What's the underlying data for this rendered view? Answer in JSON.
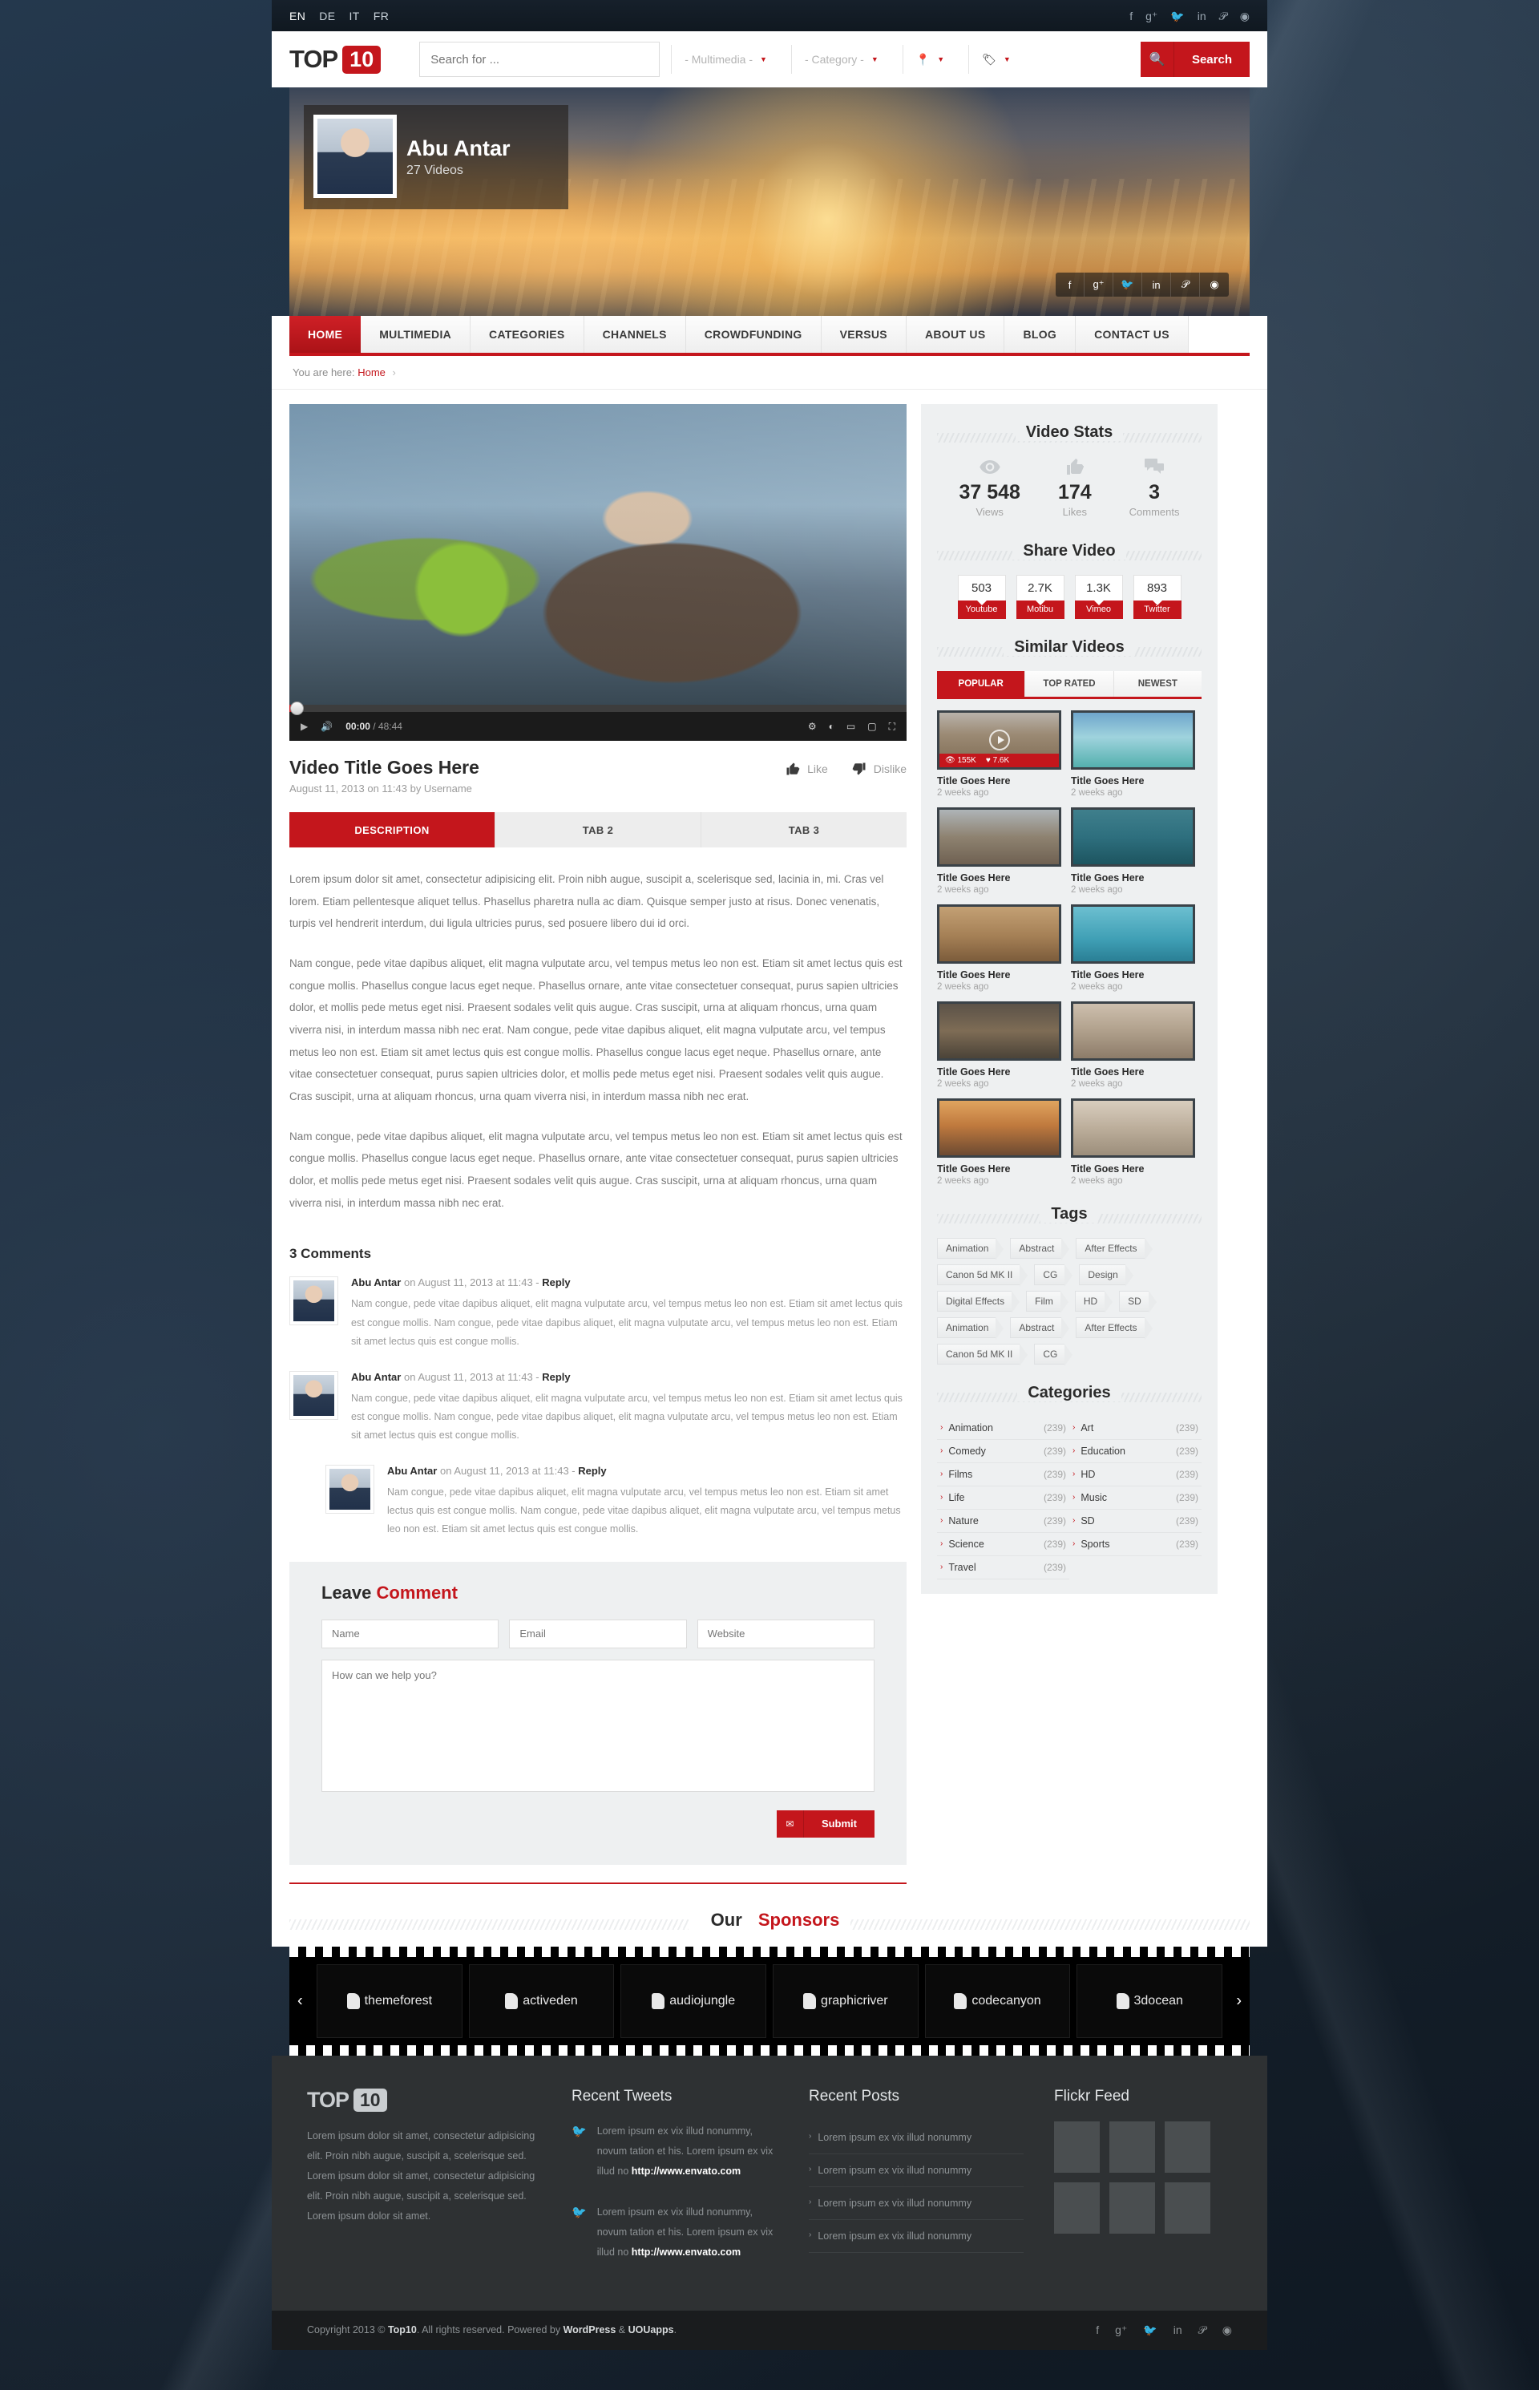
{
  "topbar": {
    "languages": [
      {
        "code": "EN",
        "active": true
      },
      {
        "code": "DE",
        "active": false
      },
      {
        "code": "IT",
        "active": false
      },
      {
        "code": "FR",
        "active": false
      }
    ],
    "social": [
      "facebook-icon",
      "google-plus-icon",
      "twitter-icon",
      "linkedin-icon",
      "pinterest-icon",
      "dribbble-icon"
    ]
  },
  "header": {
    "logo_text": "TOP",
    "logo_badge": "10",
    "search_placeholder": "Search for ...",
    "search_value": "",
    "multimedia_select": "- Multimedia -",
    "category_select": "- Category -",
    "location_icon": "map-pin-icon",
    "tag_icon": "tag-icon",
    "search_button": "Search",
    "search_icon": "search-icon"
  },
  "hero": {
    "user_name": "Abu Antar",
    "video_count": "27 Videos",
    "social": [
      "facebook-icon",
      "google-plus-icon",
      "twitter-icon",
      "linkedin-icon",
      "pinterest-icon",
      "dribbble-icon"
    ]
  },
  "nav": {
    "items": [
      {
        "label": "HOME",
        "active": true
      },
      {
        "label": "MULTIMEDIA",
        "active": false
      },
      {
        "label": "CATEGORIES",
        "active": false
      },
      {
        "label": "CHANNELS",
        "active": false
      },
      {
        "label": "CROWDFUNDING",
        "active": false
      },
      {
        "label": "VERSUS",
        "active": false
      },
      {
        "label": "ABOUT US",
        "active": false
      },
      {
        "label": "BLOG",
        "active": false
      },
      {
        "label": "CONTACT US",
        "active": false
      }
    ]
  },
  "breadcrumb": {
    "prefix": "You are here:",
    "current": "Home",
    "arrow": "›"
  },
  "player": {
    "current_time": "00:00",
    "total_time": "48:44",
    "time_separator": "/",
    "play_icon": "play-icon",
    "volume_icon": "volume-icon",
    "settings_icon": "gear-icon",
    "hd_icon": "quality-icon",
    "theater_icon": "theater-mode-icon",
    "mini_icon": "miniplayer-icon",
    "fullscreen_icon": "fullscreen-icon"
  },
  "video": {
    "title": "Video Title Goes Here",
    "meta": "August 11, 2013 on 11:43 by Username",
    "like_label": "Like",
    "dislike_label": "Dislike",
    "tabs": [
      {
        "label": "DESCRIPTION",
        "active": true
      },
      {
        "label": "TAB 2",
        "active": false
      },
      {
        "label": "TAB 3",
        "active": false
      }
    ],
    "paragraphs": [
      "Lorem ipsum dolor sit amet, consectetur adipisicing elit. Proin nibh augue, suscipit a, scelerisque sed, lacinia in, mi. Cras vel lorem. Etiam pellentesque aliquet tellus. Phasellus pharetra nulla ac diam. Quisque semper justo at risus. Donec venenatis, turpis vel hendrerit interdum, dui ligula ultricies purus, sed posuere libero dui id orci.",
      "Nam congue, pede vitae dapibus aliquet, elit magna vulputate arcu, vel tempus metus leo non est. Etiam sit amet lectus quis est congue mollis. Phasellus congue lacus eget neque. Phasellus ornare, ante vitae consectetuer consequat, purus sapien ultricies dolor, et mollis pede metus eget nisi. Praesent sodales velit quis augue. Cras suscipit, urna at aliquam rhoncus, urna quam viverra nisi, in interdum massa nibh nec erat. Nam congue, pede vitae dapibus aliquet, elit magna vulputate arcu, vel tempus metus leo non est. Etiam sit amet lectus quis est congue mollis. Phasellus congue lacus eget neque. Phasellus ornare, ante vitae consectetuer consequat, purus sapien ultricies dolor, et mollis pede metus eget nisi. Praesent sodales velit quis augue. Cras suscipit, urna at aliquam rhoncus, urna quam viverra nisi, in interdum massa nibh nec erat.",
      "Nam congue, pede vitae dapibus aliquet, elit magna vulputate arcu, vel tempus metus leo non est. Etiam sit amet lectus quis est congue mollis. Phasellus congue lacus eget neque. Phasellus ornare, ante vitae consectetuer consequat, purus sapien ultricies dolor, et mollis pede metus eget nisi. Praesent sodales velit quis augue. Cras suscipit, urna at aliquam rhoncus, urna quam viverra nisi, in interdum massa nibh nec erat."
    ]
  },
  "comments": {
    "heading": "3 Comments",
    "items": [
      {
        "author": "Abu Antar",
        "meta": " on August 11, 2013 at 11:43 - ",
        "reply": "Reply",
        "text": "Nam congue, pede vitae dapibus aliquet, elit magna vulputate arcu, vel tempus metus leo non est. Etiam sit amet lectus quis est congue mollis. Nam congue, pede vitae dapibus aliquet, elit magna vulputate arcu, vel tempus metus leo non est. Etiam sit amet lectus quis est congue mollis.",
        "indent": false
      },
      {
        "author": "Abu Antar",
        "meta": " on August 11, 2013 at 11:43 - ",
        "reply": "Reply",
        "text": "Nam congue, pede vitae dapibus aliquet, elit magna vulputate arcu, vel tempus metus leo non est. Etiam sit amet lectus quis est congue mollis. Nam congue, pede vitae dapibus aliquet, elit magna vulputate arcu, vel tempus metus leo non est. Etiam sit amet lectus quis est congue mollis.",
        "indent": false
      },
      {
        "author": "Abu Antar",
        "meta": " on August 11, 2013 at 11:43 - ",
        "reply": "Reply",
        "text": "Nam congue, pede vitae dapibus aliquet, elit magna vulputate arcu, vel tempus metus leo non est. Etiam sit amet lectus quis est congue mollis. Nam congue, pede vitae dapibus aliquet, elit magna vulputate arcu, vel tempus metus leo non est. Etiam sit amet lectus quis est congue mollis.",
        "indent": true
      }
    ]
  },
  "comment_form": {
    "heading_black": "Leave ",
    "heading_red": "Comment",
    "name_placeholder": "Name",
    "email_placeholder": "Email",
    "website_placeholder": "Website",
    "message_placeholder": "How can we help you?",
    "submit_label": "Submit",
    "submit_icon": "envelope-icon"
  },
  "sidebar": {
    "video_stats": {
      "heading": "Video Stats",
      "items": [
        {
          "icon": "eye-icon",
          "value": "37 548",
          "label": "Views"
        },
        {
          "icon": "thumbs-up-icon",
          "value": "174",
          "label": "Likes"
        },
        {
          "icon": "comment-icon",
          "value": "3",
          "label": "Comments"
        }
      ]
    },
    "share_video": {
      "heading": "Share Video",
      "items": [
        {
          "count": "503",
          "network": "Youtube"
        },
        {
          "count": "2.7K",
          "network": "Motibu"
        },
        {
          "count": "1.3K",
          "network": "Vimeo"
        },
        {
          "count": "893",
          "network": "Twitter"
        }
      ]
    },
    "similar_videos": {
      "heading": "Similar Videos",
      "tabs": [
        {
          "label": "POPULAR",
          "active": true
        },
        {
          "label": "TOP RATED",
          "active": false
        },
        {
          "label": "NEWEST",
          "active": false
        }
      ],
      "items": [
        {
          "title": "Title Goes Here",
          "age": "2 weeks ago",
          "views": "155K",
          "likes": "7.6K",
          "featured": true,
          "theme": "th-a"
        },
        {
          "title": "Title Goes Here",
          "age": "2 weeks ago",
          "featured": false,
          "theme": "th-b"
        },
        {
          "title": "Title Goes Here",
          "age": "2 weeks ago",
          "featured": false,
          "theme": "th-c"
        },
        {
          "title": "Title Goes Here",
          "age": "2 weeks ago",
          "featured": false,
          "theme": "th-d"
        },
        {
          "title": "Title Goes Here",
          "age": "2 weeks ago",
          "featured": false,
          "theme": "th-e"
        },
        {
          "title": "Title Goes Here",
          "age": "2 weeks ago",
          "featured": false,
          "theme": "th-f"
        },
        {
          "title": "Title Goes Here",
          "age": "2 weeks ago",
          "featured": false,
          "theme": "th-g"
        },
        {
          "title": "Title Goes Here",
          "age": "2 weeks ago",
          "featured": false,
          "theme": "th-h"
        },
        {
          "title": "Title Goes Here",
          "age": "2 weeks ago",
          "featured": false,
          "theme": "th-i"
        },
        {
          "title": "Title Goes Here",
          "age": "2 weeks ago",
          "featured": false,
          "theme": "th-j"
        }
      ]
    },
    "tags": {
      "heading": "Tags",
      "items": [
        "Animation",
        "Abstract",
        "After Effects",
        "Canon 5d MK II",
        "CG",
        "Design",
        "Digital Effects",
        "Film",
        "HD",
        "SD",
        "Animation",
        "Abstract",
        "After Effects",
        "Canon 5d MK II",
        "CG"
      ]
    },
    "categories": {
      "heading": "Categories",
      "items": [
        {
          "label": "Animation",
          "count": "(239)"
        },
        {
          "label": "Art",
          "count": "(239)"
        },
        {
          "label": "Comedy",
          "count": "(239)"
        },
        {
          "label": "Education",
          "count": "(239)"
        },
        {
          "label": "Films",
          "count": "(239)"
        },
        {
          "label": "HD",
          "count": "(239)"
        },
        {
          "label": "Life",
          "count": "(239)"
        },
        {
          "label": "Music",
          "count": "(239)"
        },
        {
          "label": "Nature",
          "count": "(239)"
        },
        {
          "label": "SD",
          "count": "(239)"
        },
        {
          "label": "Science",
          "count": "(239)"
        },
        {
          "label": "Sports",
          "count": "(239)"
        },
        {
          "label": "Travel",
          "count": "(239)"
        }
      ]
    }
  },
  "sponsors": {
    "heading_black": "Our ",
    "heading_red": "Sponsors",
    "prev_icon": "chevron-left-icon",
    "next_icon": "chevron-right-icon",
    "items": [
      "themeforest",
      "activeden",
      "audiojungle",
      "graphicriver",
      "codecanyon",
      "3docean"
    ]
  },
  "footer": {
    "logo_text": "TOP",
    "logo_badge": "10",
    "about": "Lorem ipsum dolor sit amet, consectetur adipisicing elit. Proin nibh augue, suscipit a, scelerisque sed. Lorem ipsum dolor sit amet, consectetur adipisicing elit. Proin nibh augue, suscipit a, scelerisque sed. Lorem ipsum dolor sit amet.",
    "tweets_heading": "Recent Tweets",
    "tweets": [
      {
        "text": "Lorem ipsum ex vix illud nonummy, novum tation et his. Lorem ipsum ex vix illud no ",
        "link": "http://www.envato.com"
      },
      {
        "text": "Lorem ipsum ex vix illud nonummy, novum tation et his. Lorem ipsum ex vix illud no ",
        "link": "http://www.envato.com"
      }
    ],
    "posts_heading": "Recent Posts",
    "posts": [
      "Lorem ipsum ex vix illud nonummy",
      "Lorem ipsum ex vix illud nonummy",
      "Lorem ipsum ex vix illud nonummy",
      "Lorem ipsum ex vix illud nonummy"
    ],
    "flickr_heading": "Flickr Feed",
    "flickr_count": 6
  },
  "copyright": {
    "prefix": "Copyright 2013 © ",
    "brand": "Top10",
    "middle": ". All rights reserved. Powered by ",
    "wordpress": "WordPress",
    "amp": " & ",
    "uouapps": "UOUapps",
    "suffix": ".",
    "social": [
      "facebook-icon",
      "google-plus-icon",
      "twitter-icon",
      "linkedin-icon",
      "pinterest-icon",
      "dribbble-icon"
    ]
  }
}
